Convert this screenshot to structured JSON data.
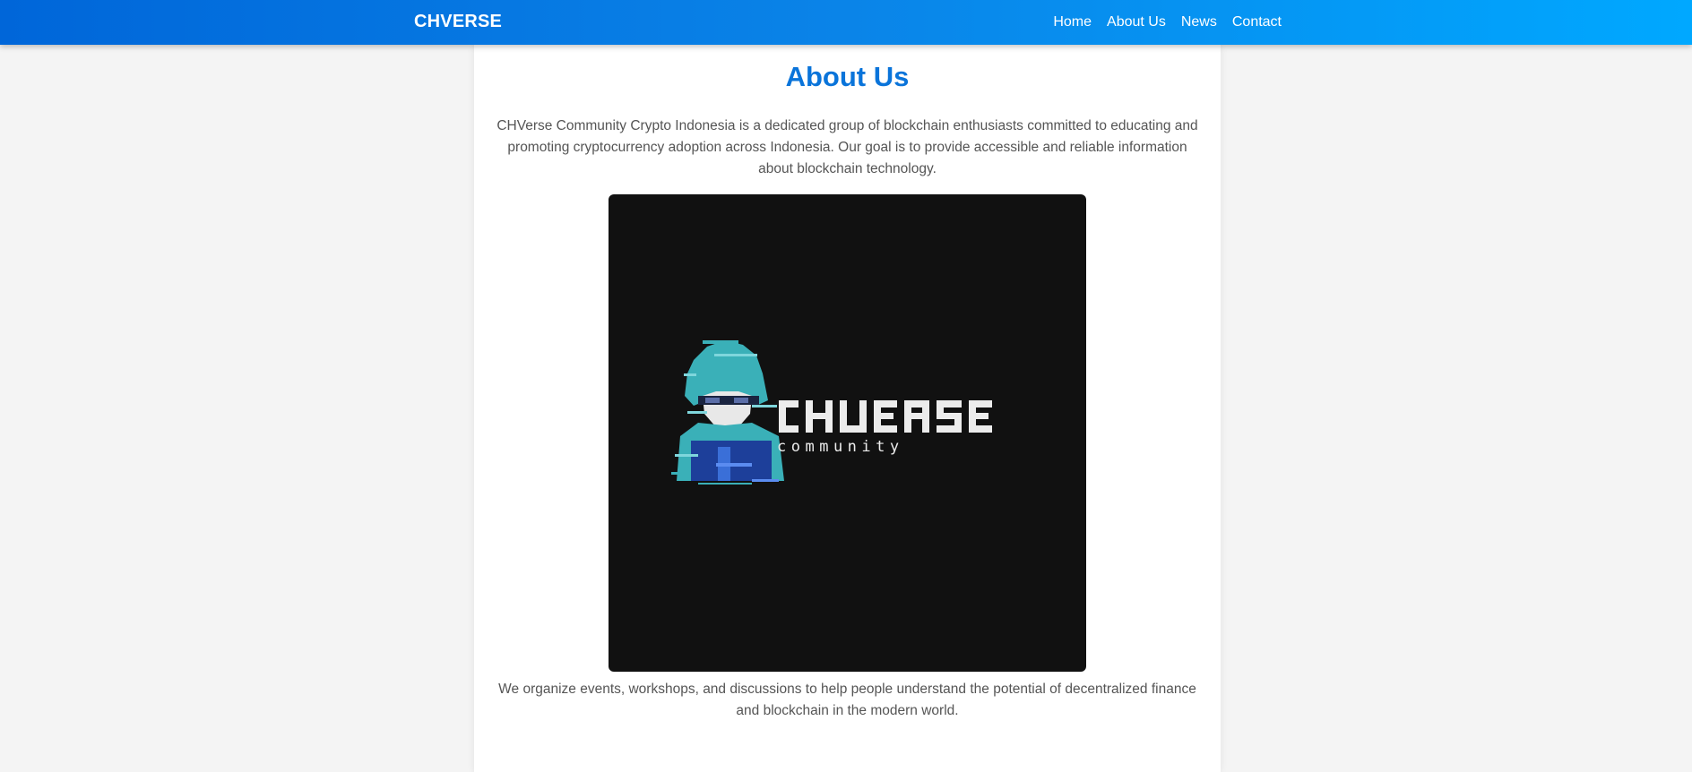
{
  "nav": {
    "brand": "CHVERSE",
    "links": [
      "Home",
      "About Us",
      "News",
      "Contact"
    ]
  },
  "main": {
    "title": "About Us",
    "intro": "CHVerse Community Crypto Indonesia is a dedicated group of blockchain enthusiasts committed to educating and promoting cryptocurrency adoption across Indonesia. Our goal is to provide accessible and reliable information about blockchain technology.",
    "logo": {
      "wordmark": "CHVERSE",
      "tagline": "community",
      "icon": "hooded-hacker-icon"
    },
    "outro": "We organize events, workshops, and discussions to help people understand the potential of decentralized finance and blockchain in the modern world."
  },
  "colors": {
    "nav_gradient_start": "#0066d9",
    "nav_gradient_end": "#00a8ff",
    "title": "#0a74da",
    "body_text": "#555555",
    "page_background": "#f4f4f4",
    "logo_background": "#111111",
    "logo_teal": "#3ab0b8"
  }
}
